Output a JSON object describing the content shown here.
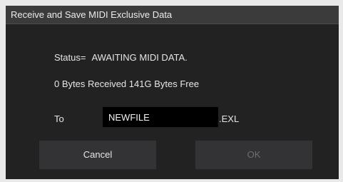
{
  "dialog": {
    "title": "Receive and Save MIDI Exclusive Data",
    "status_label": "Status=",
    "status_value": "AWAITING MIDI DATA.",
    "bytes_info": "0 Bytes Received 141G Bytes Free",
    "to_label": "To",
    "filename": "NEWFILE",
    "extension": ".EXL",
    "cancel_label": "Cancel",
    "ok_label": "OK",
    "ok_enabled": false
  }
}
